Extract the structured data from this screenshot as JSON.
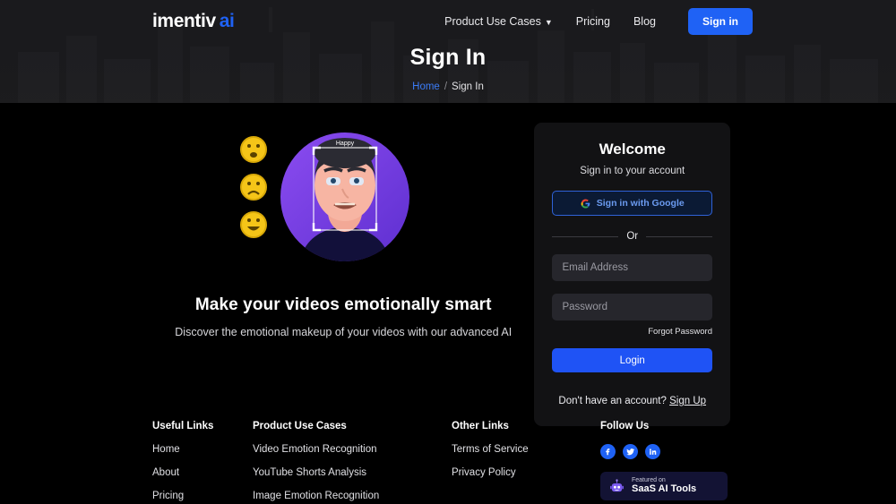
{
  "header": {
    "logo_word": "imentiv",
    "logo_ai": "ai",
    "nav": [
      {
        "label": "Product Use Cases",
        "has_chevron": true
      },
      {
        "label": "Pricing",
        "has_chevron": false
      },
      {
        "label": "Blog",
        "has_chevron": false
      }
    ],
    "signin_button": "Sign in",
    "page_title": "Sign In",
    "breadcrumb": {
      "home": "Home",
      "separator": "/",
      "current": "Sign In"
    }
  },
  "hero_left": {
    "tagline": "Make your videos emotionally smart",
    "subtitle": "Discover the emotional makeup of your videos with our advanced AI",
    "illustration": {
      "name": "face-emotion-detection-illustration",
      "circle_color": "#7B3FE4",
      "emoji_color": "#F5C518",
      "emojis": [
        "neutral-face",
        "sad-face",
        "happy-face"
      ],
      "face_label": "Happy"
    }
  },
  "card": {
    "title": "Welcome",
    "subtitle": "Sign in to your account",
    "google_button": "Sign in with Google",
    "divider_text": "Or",
    "email_placeholder": "Email Address",
    "email_value": "",
    "password_placeholder": "Password",
    "password_value": "",
    "forgot_password": "Forgot Password",
    "login_button": "Login",
    "signup_prompt": "Don't have an account?",
    "signup_link": "Sign Up"
  },
  "footer": {
    "col1": {
      "heading": "Useful Links",
      "links": [
        "Home",
        "About",
        "Pricing"
      ]
    },
    "col2": {
      "heading": "Product Use Cases",
      "links": [
        "Video Emotion Recognition",
        "YouTube Shorts Analysis",
        "Image Emotion Recognition"
      ]
    },
    "col3": {
      "heading": "Other Links",
      "links": [
        "Terms of Service",
        "Privacy Policy"
      ]
    },
    "col4": {
      "heading": "Follow Us",
      "socials": [
        "facebook-icon",
        "twitter-icon",
        "linkedin-icon"
      ],
      "badge_small": "Featured on",
      "badge_large": "SaaS AI Tools"
    }
  },
  "colors": {
    "accent_blue": "#1F62F5",
    "link_blue": "#3B7CF7",
    "card_bg": "#121214",
    "input_bg": "#26262C",
    "page_bg": "#000000",
    "hero_bg": "#1C1C1F"
  }
}
